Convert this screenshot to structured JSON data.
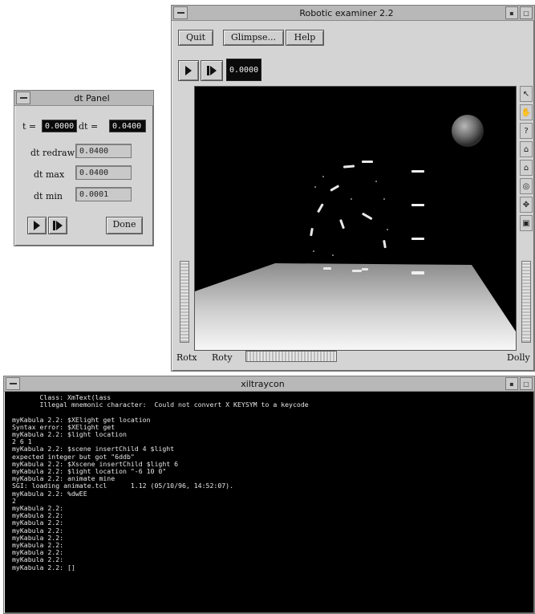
{
  "dt_panel": {
    "title": "dt Panel",
    "t_label": "t =",
    "t_value": "0.0000",
    "dt_label": "dt =",
    "dt_value": "0.0400",
    "dt_redraw_label": "dt redraw",
    "dt_redraw_value": "0.0400",
    "dt_max_label": "dt max",
    "dt_max_value": "0.0400",
    "dt_min_label": "dt min",
    "dt_min_value": "0.0001",
    "done_label": "Done"
  },
  "examiner": {
    "title": "Robotic examiner 2.2",
    "quit_label": "Quit",
    "glimpse_label": "Glimpse...",
    "help_label": "Help",
    "time_display": "0.0000",
    "rotx_label": "Rotx",
    "roty_label": "Roty",
    "dolly_label": "Dolly",
    "tools": [
      "pointer-icon",
      "hand-icon",
      "question-icon",
      "home-icon",
      "set-home-icon",
      "camera-icon",
      "center-icon",
      "perspective-icon"
    ]
  },
  "terminal": {
    "title": "xiltraycon",
    "lines": [
      "       Class: XmText(lass",
      "       Illegal mnemonic character:  Could not convert X KEYSYM to a keycode",
      "",
      "myKabula 2.2: $XElight get location",
      "Syntax error: $XElight get",
      "myKabula 2.2: $light location",
      "2 6 1",
      "myKabula 2.2: $scene insertChild 4 $light",
      "expected integer but got \"6ddb\"",
      "myKabula 2.2: $Xscene insertChild $light 6",
      "myKabula 2.2: $light location \"-6 10 0\"",
      "myKabula 2.2: animate mine",
      "SGI: loading animate.tcl      1.12 (05/10/96, 14:52:07).",
      "myKabula 2.2: %dwEE",
      "2",
      "myKabula 2.2:",
      "myKabula 2.2:",
      "myKabula 2.2:",
      "myKabula 2.2:",
      "myKabula 2.2:",
      "myKabula 2.2:",
      "myKabula 2.2:",
      "myKabula 2.2:",
      "myKabula 2.2: []"
    ]
  }
}
